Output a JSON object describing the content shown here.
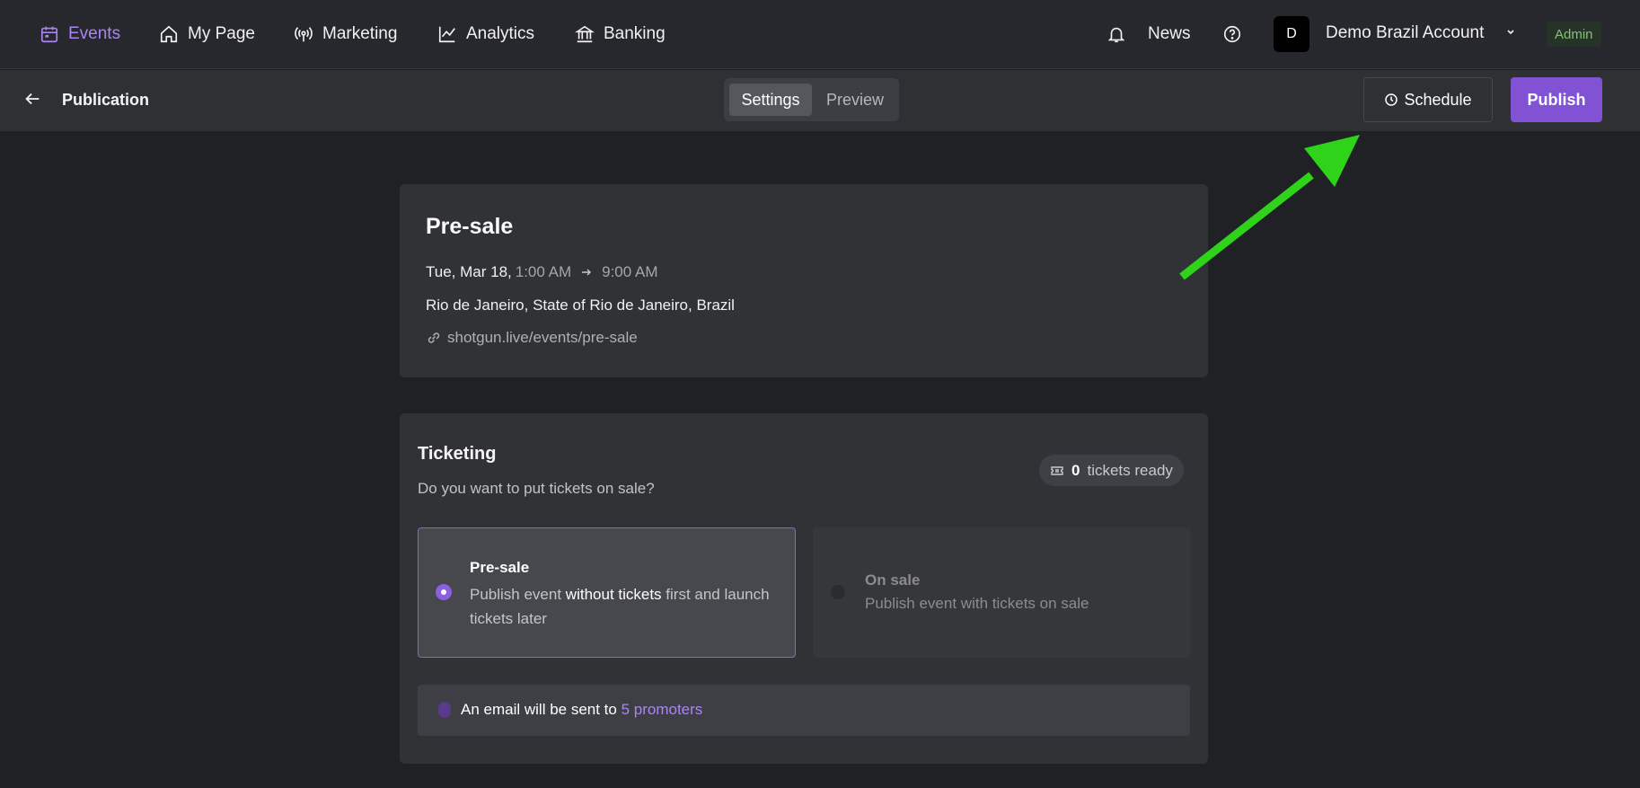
{
  "nav": {
    "items": [
      {
        "label": "Events",
        "icon": "calendar-icon",
        "active": true
      },
      {
        "label": "My Page",
        "icon": "home-icon"
      },
      {
        "label": "Marketing",
        "icon": "broadcast-icon"
      },
      {
        "label": "Analytics",
        "icon": "line-chart-icon"
      },
      {
        "label": "Banking",
        "icon": "bank-icon"
      }
    ],
    "news_label": "News",
    "account": {
      "initial": "D",
      "name": "Demo Brazil Account",
      "role": "Admin"
    }
  },
  "subbar": {
    "title": "Publication",
    "tabs": [
      "Settings",
      "Preview"
    ],
    "active_tab": "Settings",
    "schedule_label": "Schedule",
    "publish_label": "Publish"
  },
  "event": {
    "title": "Pre-sale",
    "date": "Tue, Mar 18,",
    "start_time": "1:00 AM",
    "end_time": "9:00 AM",
    "location": "Rio de Janeiro, State of Rio de Janeiro, Brazil",
    "link": "shotgun.live/events/pre-sale"
  },
  "ticketing": {
    "title": "Ticketing",
    "subtitle": "Do you want to put tickets on sale?",
    "tickets_count": "0",
    "tickets_label": "tickets ready",
    "options": [
      {
        "title": "Pre-sale",
        "desc_a": "Publish event ",
        "desc_b": "without tickets",
        "desc_c": " first and launch tickets later",
        "selected": true
      },
      {
        "title": "On sale",
        "desc": "Publish event with tickets on sale",
        "selected": false
      }
    ],
    "notice_text": "An email will be sent to ",
    "notice_link": "5 promoters"
  },
  "colors": {
    "accent": "#8152d4",
    "annotation_arrow": "#2fd41a"
  }
}
